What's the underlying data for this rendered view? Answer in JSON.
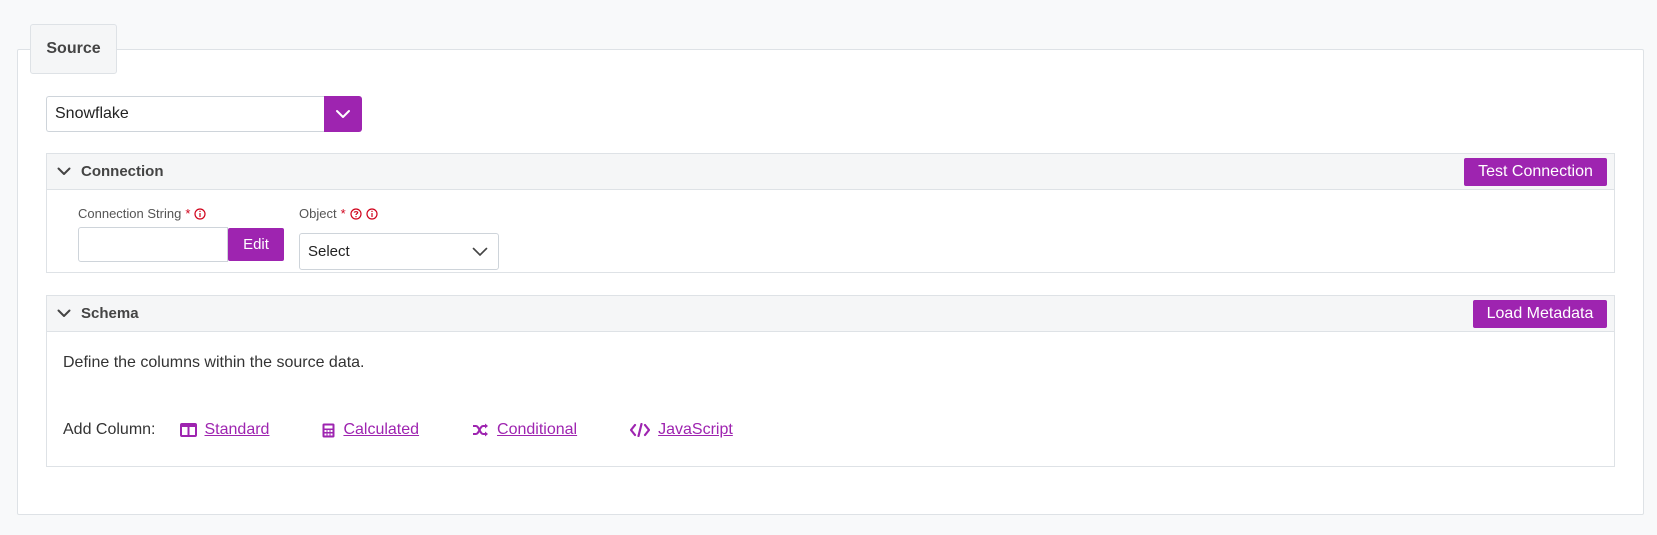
{
  "panel": {
    "tab_label": "Source"
  },
  "source_select": {
    "value": "Snowflake"
  },
  "connection": {
    "title": "Connection",
    "test_button": "Test Connection",
    "connection_string": {
      "label": "Connection String",
      "required_mark": "*",
      "value": "",
      "edit_button": "Edit"
    },
    "object": {
      "label": "Object",
      "required_mark": "*",
      "value": "Select"
    }
  },
  "schema": {
    "title": "Schema",
    "load_button": "Load Metadata",
    "description": "Define the columns within the source data.",
    "add_column_label": "Add Column:",
    "column_types": [
      {
        "label": "Standard",
        "icon": "table-columns-icon"
      },
      {
        "label": "Calculated",
        "icon": "calculator-icon"
      },
      {
        "label": "Conditional",
        "icon": "shuffle-icon"
      },
      {
        "label": "JavaScript",
        "icon": "code-icon"
      }
    ]
  },
  "colors": {
    "accent": "#9e24b0",
    "required": "#d0021b",
    "header_bg": "#f5f6f7",
    "border": "#dee2e6"
  }
}
